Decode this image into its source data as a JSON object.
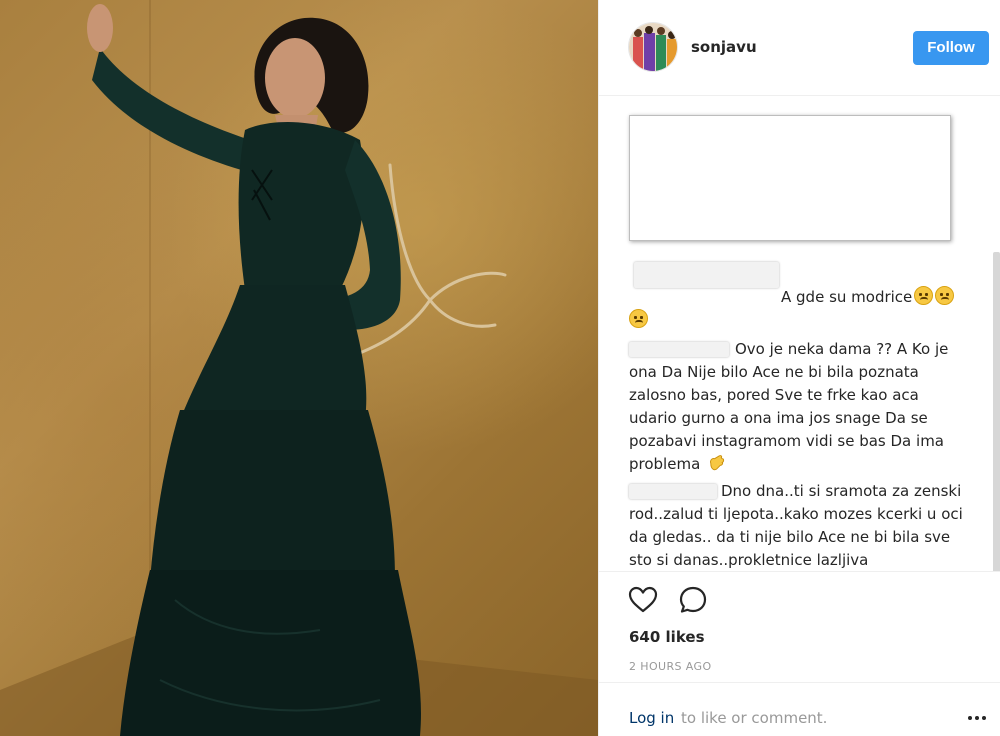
{
  "post": {
    "username": "sonjavu",
    "follow_label": "Follow"
  },
  "comments": [
    {
      "author_redacted": true,
      "text": "A gde su modrice"
    },
    {
      "author_redacted": true,
      "text": "Ovo je neka dama ?? A Ko je ona Da Nije bilo Ace ne bi bila poznata zalosno bas, pored Sve te frke kao aca udario gurno a ona ima jos snage Da se pozabavi instagramom vidi se bas Da ima problema"
    },
    {
      "author_redacted": true,
      "text": "Dno dna..ti si sramota za zenski rod..zalud ti ljepota..kako mozes kcerki u oci da gledas.. da ti nije bilo Ace ne bi bila sve sto si danas..prokletnice lazljiva"
    }
  ],
  "comment_lines": {
    "c1_l1": "A gde su modrice",
    "c2_l1": "Ovo je neka dama ?? A Ko je",
    "c2_l2": "ona Da Nije bilo Ace ne bi bila poznata",
    "c2_l3": "zalosno bas, pored Sve te frke kao aca",
    "c2_l4": "udario gurno a ona ima jos snage Da se",
    "c2_l5": "pozabavi instagramom vidi se bas Da ima",
    "c2_l6": "problema",
    "c3_l1": "Dno dna..ti si sramota za zenski",
    "c3_l2": "rod..zalud ti ljepota..kako mozes kcerki u oci",
    "c3_l3": "da gledas.. da ti nije bilo Ace ne bi bila sve",
    "c3_l4": "sto si danas..prokletnice lazljiva"
  },
  "stats": {
    "likes": "640 likes",
    "timestamp": "2 HOURS AGO"
  },
  "footer": {
    "login_link": "Log in",
    "login_rest": "to like or comment."
  },
  "icons": {
    "like": "heart-icon",
    "comment": "speech-bubble-icon",
    "more": "more-options-icon"
  },
  "colors": {
    "follow_blue": "#3897f0",
    "link_navy": "#003569",
    "muted_gray": "#999999",
    "photo_background": "#a9803f",
    "dress": "#0f2622"
  }
}
